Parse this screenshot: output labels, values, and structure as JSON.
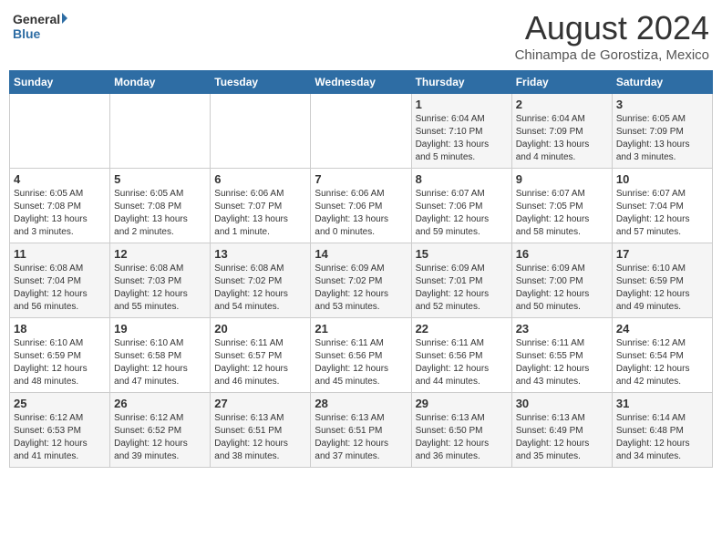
{
  "header": {
    "logo_general": "General",
    "logo_blue": "Blue",
    "month_year": "August 2024",
    "location": "Chinampa de Gorostiza, Mexico"
  },
  "weekdays": [
    "Sunday",
    "Monday",
    "Tuesday",
    "Wednesday",
    "Thursday",
    "Friday",
    "Saturday"
  ],
  "weeks": [
    [
      {
        "day": "",
        "text": ""
      },
      {
        "day": "",
        "text": ""
      },
      {
        "day": "",
        "text": ""
      },
      {
        "day": "",
        "text": ""
      },
      {
        "day": "1",
        "text": "Sunrise: 6:04 AM\nSunset: 7:10 PM\nDaylight: 13 hours\nand 5 minutes."
      },
      {
        "day": "2",
        "text": "Sunrise: 6:04 AM\nSunset: 7:09 PM\nDaylight: 13 hours\nand 4 minutes."
      },
      {
        "day": "3",
        "text": "Sunrise: 6:05 AM\nSunset: 7:09 PM\nDaylight: 13 hours\nand 3 minutes."
      }
    ],
    [
      {
        "day": "4",
        "text": "Sunrise: 6:05 AM\nSunset: 7:08 PM\nDaylight: 13 hours\nand 3 minutes."
      },
      {
        "day": "5",
        "text": "Sunrise: 6:05 AM\nSunset: 7:08 PM\nDaylight: 13 hours\nand 2 minutes."
      },
      {
        "day": "6",
        "text": "Sunrise: 6:06 AM\nSunset: 7:07 PM\nDaylight: 13 hours\nand 1 minute."
      },
      {
        "day": "7",
        "text": "Sunrise: 6:06 AM\nSunset: 7:06 PM\nDaylight: 13 hours\nand 0 minutes."
      },
      {
        "day": "8",
        "text": "Sunrise: 6:07 AM\nSunset: 7:06 PM\nDaylight: 12 hours\nand 59 minutes."
      },
      {
        "day": "9",
        "text": "Sunrise: 6:07 AM\nSunset: 7:05 PM\nDaylight: 12 hours\nand 58 minutes."
      },
      {
        "day": "10",
        "text": "Sunrise: 6:07 AM\nSunset: 7:04 PM\nDaylight: 12 hours\nand 57 minutes."
      }
    ],
    [
      {
        "day": "11",
        "text": "Sunrise: 6:08 AM\nSunset: 7:04 PM\nDaylight: 12 hours\nand 56 minutes."
      },
      {
        "day": "12",
        "text": "Sunrise: 6:08 AM\nSunset: 7:03 PM\nDaylight: 12 hours\nand 55 minutes."
      },
      {
        "day": "13",
        "text": "Sunrise: 6:08 AM\nSunset: 7:02 PM\nDaylight: 12 hours\nand 54 minutes."
      },
      {
        "day": "14",
        "text": "Sunrise: 6:09 AM\nSunset: 7:02 PM\nDaylight: 12 hours\nand 53 minutes."
      },
      {
        "day": "15",
        "text": "Sunrise: 6:09 AM\nSunset: 7:01 PM\nDaylight: 12 hours\nand 52 minutes."
      },
      {
        "day": "16",
        "text": "Sunrise: 6:09 AM\nSunset: 7:00 PM\nDaylight: 12 hours\nand 50 minutes."
      },
      {
        "day": "17",
        "text": "Sunrise: 6:10 AM\nSunset: 6:59 PM\nDaylight: 12 hours\nand 49 minutes."
      }
    ],
    [
      {
        "day": "18",
        "text": "Sunrise: 6:10 AM\nSunset: 6:59 PM\nDaylight: 12 hours\nand 48 minutes."
      },
      {
        "day": "19",
        "text": "Sunrise: 6:10 AM\nSunset: 6:58 PM\nDaylight: 12 hours\nand 47 minutes."
      },
      {
        "day": "20",
        "text": "Sunrise: 6:11 AM\nSunset: 6:57 PM\nDaylight: 12 hours\nand 46 minutes."
      },
      {
        "day": "21",
        "text": "Sunrise: 6:11 AM\nSunset: 6:56 PM\nDaylight: 12 hours\nand 45 minutes."
      },
      {
        "day": "22",
        "text": "Sunrise: 6:11 AM\nSunset: 6:56 PM\nDaylight: 12 hours\nand 44 minutes."
      },
      {
        "day": "23",
        "text": "Sunrise: 6:11 AM\nSunset: 6:55 PM\nDaylight: 12 hours\nand 43 minutes."
      },
      {
        "day": "24",
        "text": "Sunrise: 6:12 AM\nSunset: 6:54 PM\nDaylight: 12 hours\nand 42 minutes."
      }
    ],
    [
      {
        "day": "25",
        "text": "Sunrise: 6:12 AM\nSunset: 6:53 PM\nDaylight: 12 hours\nand 41 minutes."
      },
      {
        "day": "26",
        "text": "Sunrise: 6:12 AM\nSunset: 6:52 PM\nDaylight: 12 hours\nand 39 minutes."
      },
      {
        "day": "27",
        "text": "Sunrise: 6:13 AM\nSunset: 6:51 PM\nDaylight: 12 hours\nand 38 minutes."
      },
      {
        "day": "28",
        "text": "Sunrise: 6:13 AM\nSunset: 6:51 PM\nDaylight: 12 hours\nand 37 minutes."
      },
      {
        "day": "29",
        "text": "Sunrise: 6:13 AM\nSunset: 6:50 PM\nDaylight: 12 hours\nand 36 minutes."
      },
      {
        "day": "30",
        "text": "Sunrise: 6:13 AM\nSunset: 6:49 PM\nDaylight: 12 hours\nand 35 minutes."
      },
      {
        "day": "31",
        "text": "Sunrise: 6:14 AM\nSunset: 6:48 PM\nDaylight: 12 hours\nand 34 minutes."
      }
    ]
  ]
}
